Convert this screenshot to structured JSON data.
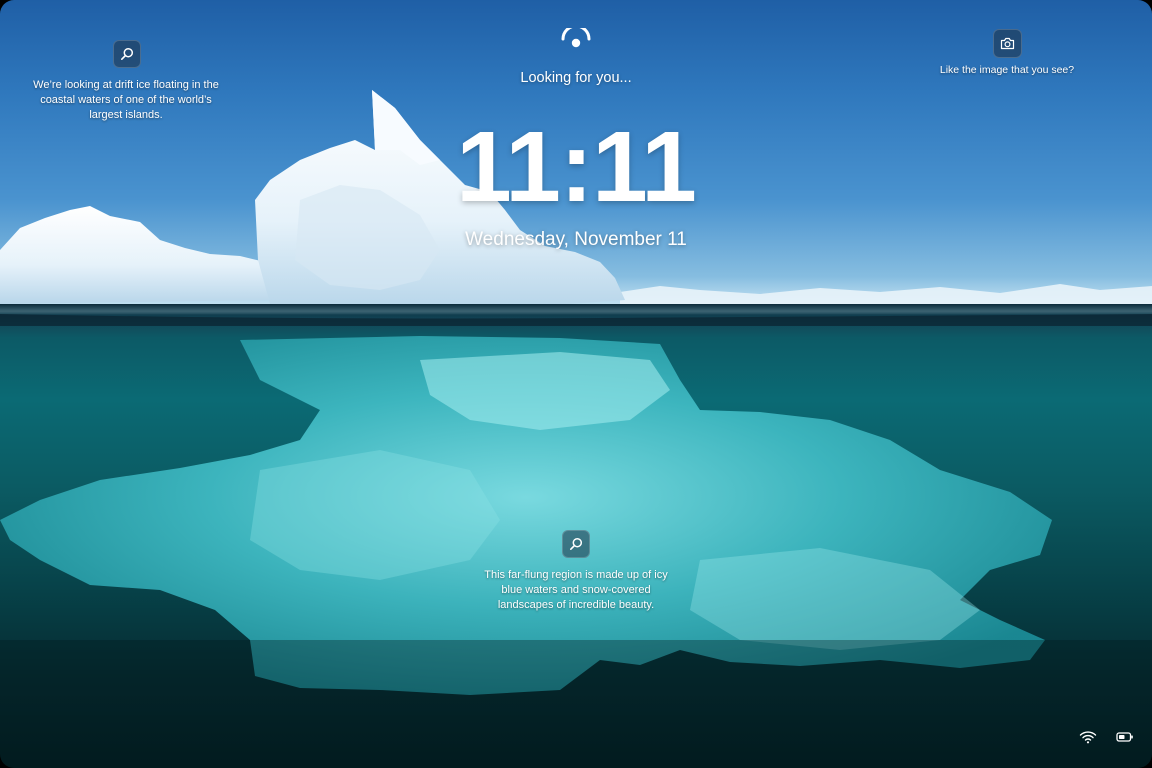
{
  "lockscreen": {
    "status_text": "Looking for you...",
    "time": "11:11",
    "date": "Wednesday, November 11",
    "hotspot_top_left": {
      "icon": "search-icon",
      "text": "We’re looking at drift ice floating in the coastal waters of one of the world’s largest islands."
    },
    "hotspot_bottom": {
      "icon": "search-icon",
      "text": "This far-flung region is made up of icy blue waters and snow-covered landscapes of incredible beauty."
    },
    "camera_prompt": {
      "icon": "camera-icon",
      "text": "Like the image that you see?"
    },
    "face_icon": "face-recognition-icon",
    "tray": {
      "wifi_icon": "wifi-icon",
      "battery_icon": "battery-icon"
    }
  }
}
